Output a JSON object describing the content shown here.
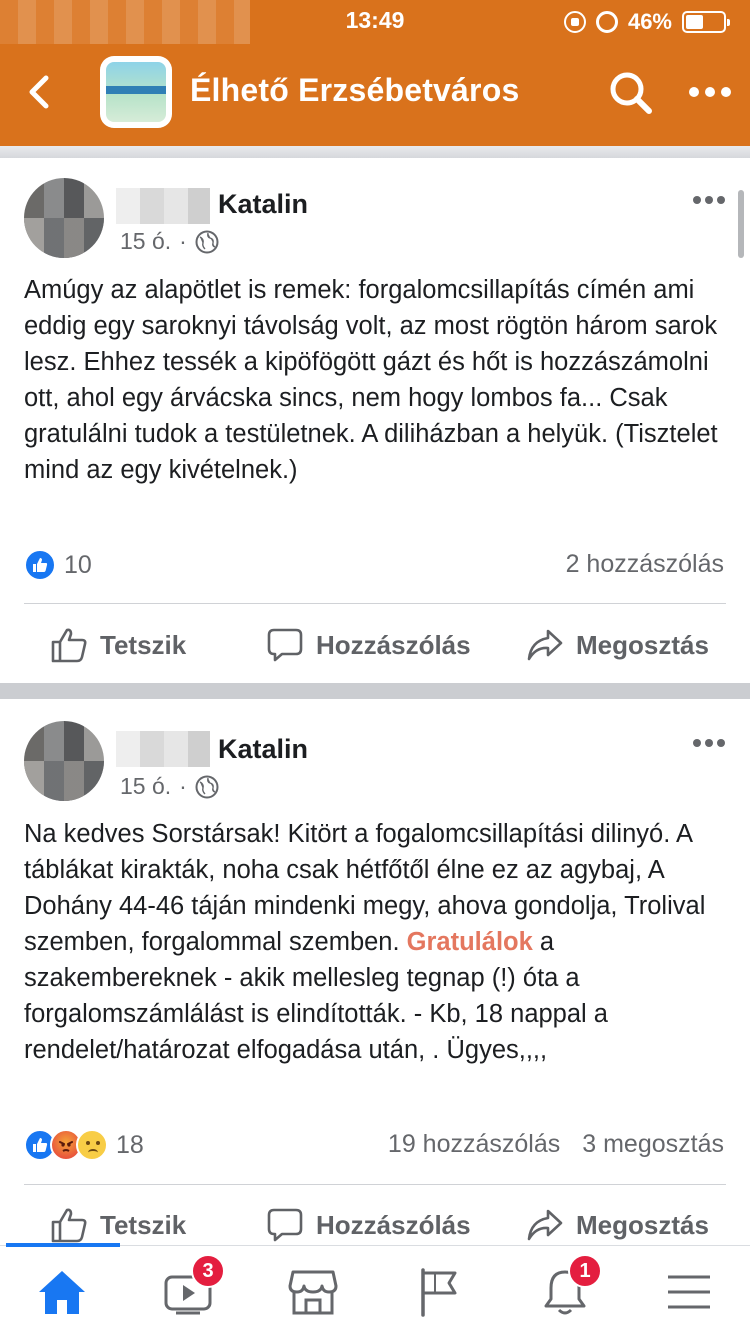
{
  "status_bar": {
    "time": "13:49",
    "battery_percent": "46%",
    "battery_level": 0.46
  },
  "header": {
    "title": "Élhető Erzsébetváros",
    "icons": [
      "back-icon",
      "group-avatar",
      "search-icon",
      "more-icon"
    ]
  },
  "posts": [
    {
      "author": "Katalin",
      "time": "15 ó.",
      "meta_sep": "·",
      "text": "Amúgy az alapötlet is remek: forgalomcsillapítás címén ami eddig egy saroknyi távolság volt, az most rögtön három sarok lesz. Ehhez tessék a kipöfögött gázt és hőt is hozzászámolni ott, ahol egy árvácska sincs, nem hogy lombos fa... Csak gratulálni tudok a testületnek. A diliházban a helyük. (Tisztelet mind az egy kivételnek.)",
      "reaction_count": "10",
      "comments": "2 hozzászólás"
    },
    {
      "author": "Katalin",
      "time": "15 ó.",
      "meta_sep": "·",
      "text_before": "Na kedves Sorstársak!  Kitört a fogalomcsillapítási dilinyó. A táblákat kirakták, noha csak hétfőtől élne ez az agybaj, A Dohány 44-46 táján  mindenki megy, ahova gondolja, Trolival szemben, forgalommal szemben. ",
      "text_highlight": "Gratulálok",
      "text_after": " a szakembereknek - akik mellesleg tegnap (!) óta a forgalomszámlálást is elindították. - Kb, 18 nappal a rendelet/határozat elfogadása után, . Ügyes,,,,",
      "reaction_count": "18",
      "comments": "19 hozzászólás",
      "shares": "3 megosztás"
    }
  ],
  "actions": {
    "like": "Tetszik",
    "comment": "Hozzászólás",
    "share": "Megosztás"
  },
  "tabbar": {
    "items": [
      "home-icon",
      "watch-icon",
      "marketplace-icon",
      "pages-icon",
      "notifications-icon",
      "menu-icon"
    ],
    "watch_badge": "3",
    "notifications_badge": "1"
  },
  "colors": {
    "header": "#d9721c",
    "accent": "#1877f2",
    "highlight": "#e4775f",
    "badge": "#e41e3f"
  }
}
